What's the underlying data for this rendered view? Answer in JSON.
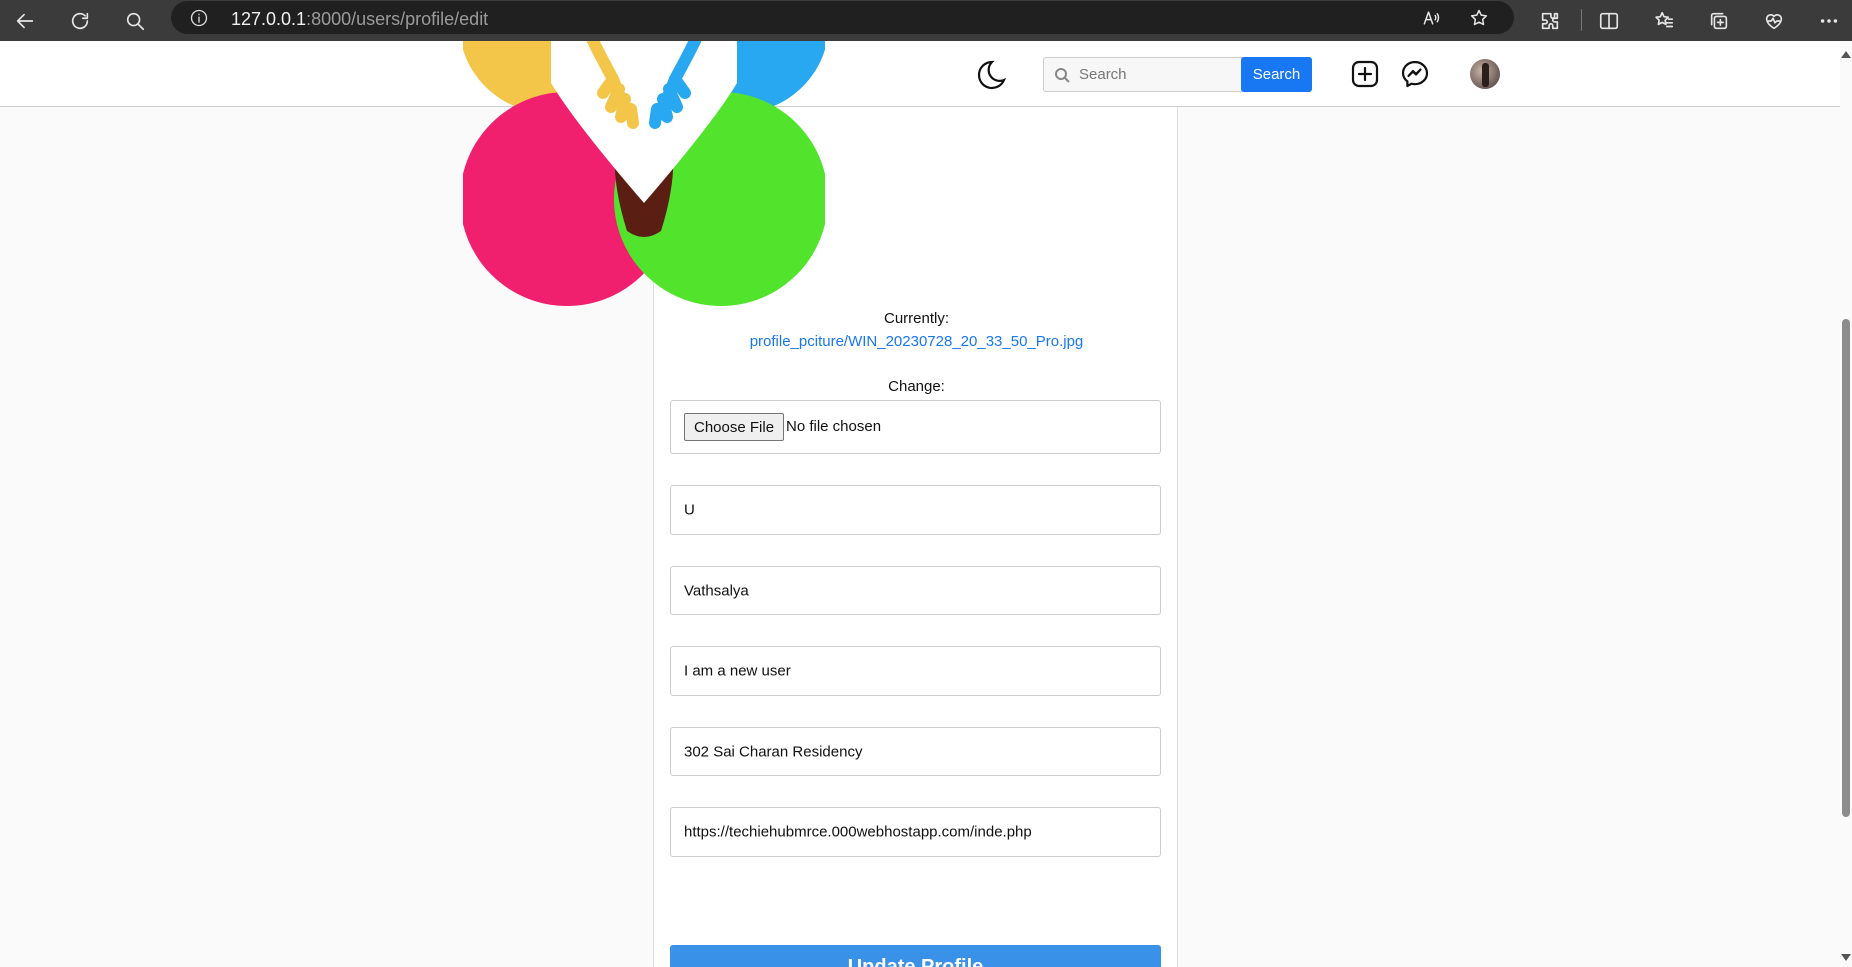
{
  "browser": {
    "url_host": "127.0.0.1",
    "url_rest": ":8000/users/profile/edit"
  },
  "navbar": {
    "search_placeholder": "Search",
    "search_button": "Search"
  },
  "form": {
    "currently_label": "Currently:",
    "current_file_link": "profile_pciture/WIN_20230728_20_33_50_Pro.jpg",
    "change_label": "Change:",
    "choose_file_button": "Choose File",
    "no_file_text": "No file chosen",
    "fields": [
      "U",
      "Vathsalya",
      "I am a new user",
      "302 Sai Charan Residency",
      "https://techiehubmrce.000webhostapp.com/inde.php"
    ],
    "submit_label": "Update Profile"
  },
  "colors": {
    "brand_blue": "#1877f2",
    "update_button": "#3a92e8",
    "logo_pink": "#f0206f",
    "logo_green": "#52e42c",
    "logo_yellow": "#f3c64a",
    "logo_blue": "#27a8f0"
  }
}
